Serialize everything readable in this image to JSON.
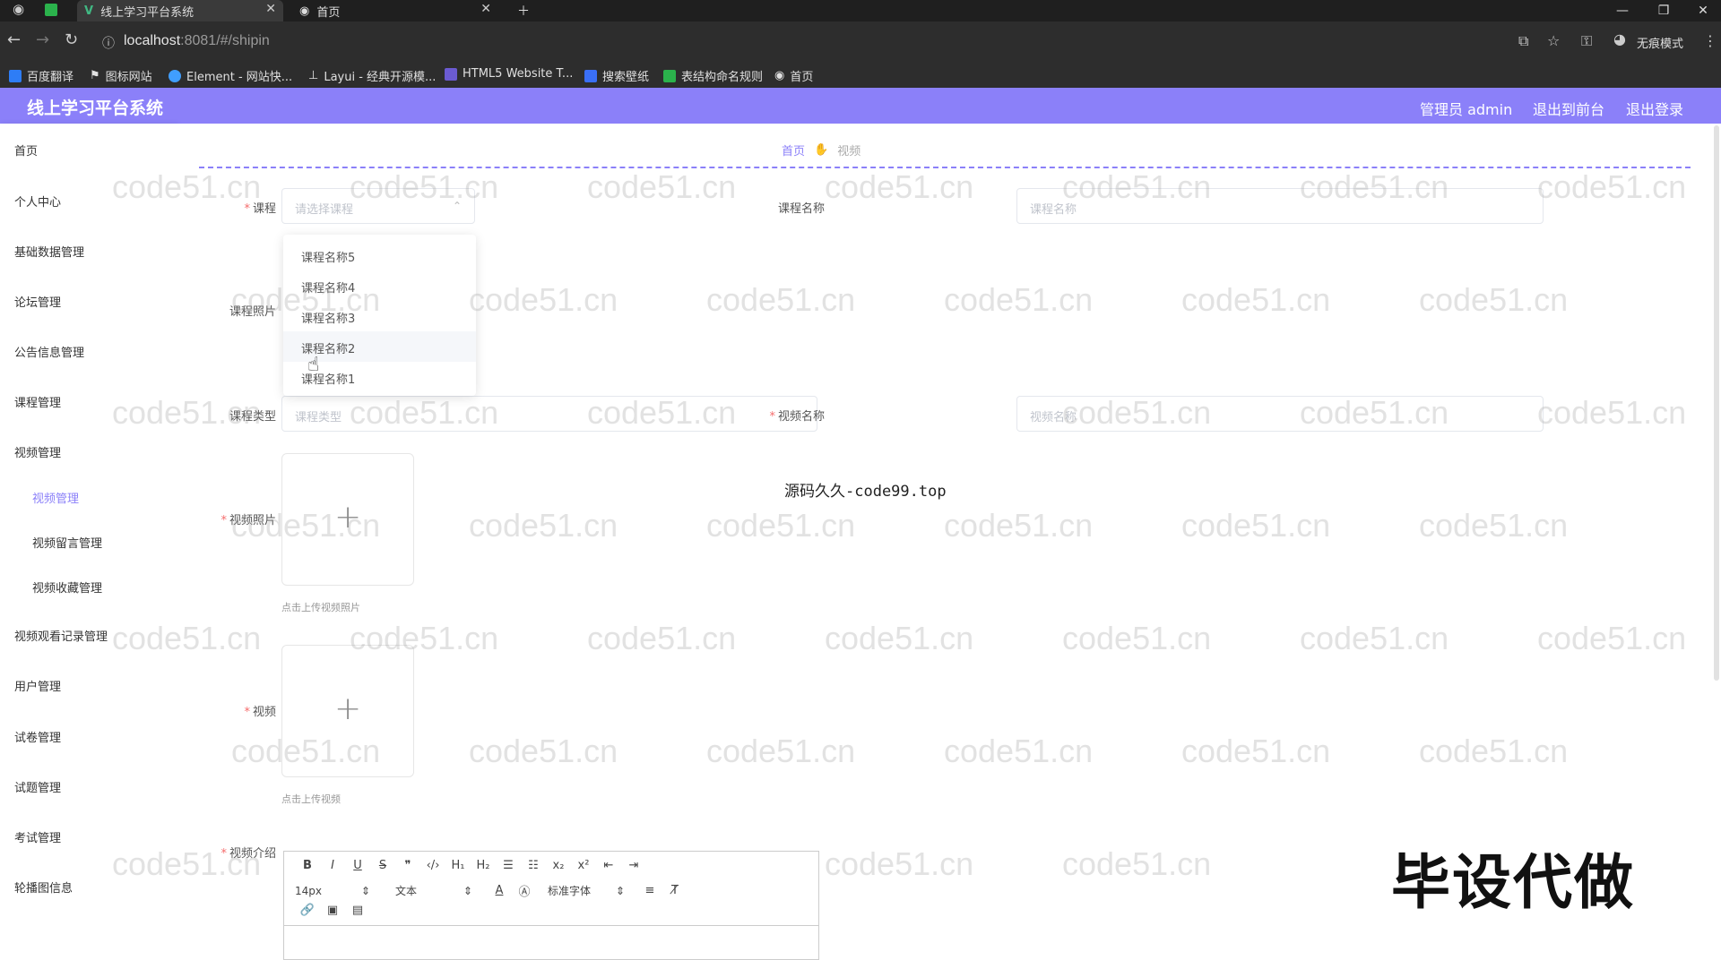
{
  "browser": {
    "tabs": [
      {
        "title": "线上学习平台系统"
      },
      {
        "title": "首页"
      }
    ],
    "url_host": "localhost",
    "url_rest": ":8081/#/shipin",
    "incognito": "无痕模式",
    "bookmarks": [
      "百度翻译",
      "图标网站",
      "Element - 网站快...",
      "Layui - 经典开源模...",
      "HTML5 Website T...",
      "搜索壁纸",
      "表结构命名规则",
      "首页"
    ]
  },
  "header": {
    "title": "线上学习平台系统",
    "admin": "管理员 admin",
    "to_front": "退出到前台",
    "logout": "退出登录"
  },
  "sidebar": {
    "items": [
      "首页",
      "个人中心",
      "基础数据管理",
      "论坛管理",
      "公告信息管理",
      "课程管理",
      "视频管理"
    ],
    "sub_items": [
      "视频管理",
      "视频留言管理",
      "视频收藏管理"
    ],
    "items_after": [
      "视频观看记录管理",
      "用户管理",
      "试卷管理",
      "试题管理",
      "考试管理",
      "轮播图信息"
    ]
  },
  "breadcrumb": {
    "home": "首页",
    "current": "视频"
  },
  "form": {
    "course_label": "课程",
    "course_placeholder": "请选择课程",
    "course_name_label": "课程名称",
    "course_name_placeholder": "课程名称",
    "course_photo_label": "课程照片",
    "course_type_label": "课程类型",
    "course_type_placeholder": "课程类型",
    "video_name_label": "视频名称",
    "video_name_placeholder": "视频名称",
    "video_photo_label": "视频照片",
    "video_photo_hint": "点击上传视频照片",
    "video_label": "视频",
    "video_hint": "点击上传视频",
    "video_intro_label": "视频介绍"
  },
  "dropdown": {
    "options": [
      "课程名称5",
      "课程名称4",
      "课程名称3",
      "课程名称2",
      "课程名称1"
    ],
    "hovered_index": 3
  },
  "editor": {
    "font_size": "14px",
    "header_select": "文本",
    "font_family": "标准字体"
  },
  "overlay": {
    "source_text": "源码久久-code99.top",
    "big_text": "毕设代做",
    "watermark": "code51.cn"
  },
  "colors": {
    "accent": "#8b80f9",
    "required": "#f56c6c"
  }
}
